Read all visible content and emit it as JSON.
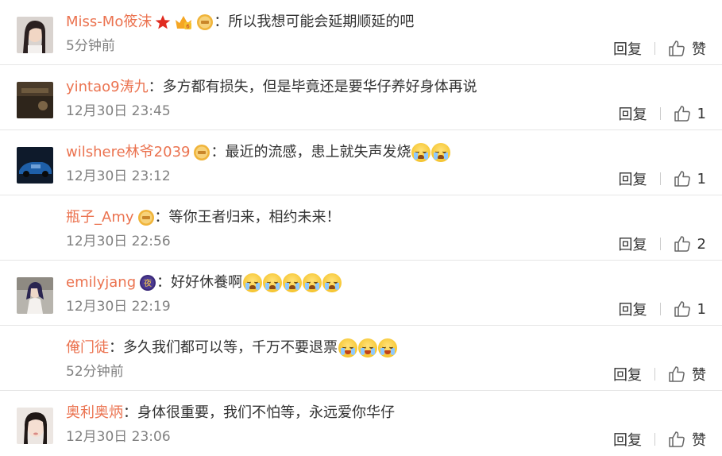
{
  "comments": [
    {
      "username": "Miss-Mo筱沫",
      "separator": "：",
      "text": "所以我想可能会延期顺延的吧",
      "time": "5分钟前",
      "reply_label": "回复",
      "like_label": "赞",
      "badges": [
        "star-badge",
        "crown-vip-badge",
        "gold-fan-badge"
      ],
      "emojis": []
    },
    {
      "username": "yintao9涛九",
      "separator": "：",
      "text": "多方都有损失，但是毕竟还是要华仔养好身体再说",
      "time": "12月30日 23:45",
      "reply_label": "回复",
      "like_label": "1",
      "badges": [],
      "emojis": []
    },
    {
      "username": "wilshere林爷2039",
      "separator": "：",
      "text": "最近的流感，患上就失声发烧",
      "time": "12月30日 23:12",
      "reply_label": "回复",
      "like_label": "1",
      "badges": [
        "gold-fan-badge"
      ],
      "emojis": [
        "crying-emoji",
        "crying-emoji"
      ]
    },
    {
      "username": "瓶子_Amy",
      "separator": "：",
      "text": "等你王者归来，相约未来！",
      "time": "12月30日 22:56",
      "reply_label": "回复",
      "like_label": "2",
      "badges": [
        "gold-fan-badge"
      ],
      "emojis": []
    },
    {
      "username": "emilyjang",
      "separator": "：",
      "text": "好好休養啊",
      "time": "12月30日 22:19",
      "reply_label": "回复",
      "like_label": "1",
      "badges": [
        "night-badge"
      ],
      "emojis": [
        "crying-emoji",
        "crying-emoji",
        "crying-emoji",
        "crying-emoji",
        "crying-emoji"
      ]
    },
    {
      "username": "俺门徒",
      "separator": "：",
      "text": "多久我们都可以等，千万不要退票",
      "time": "52分钟前",
      "reply_label": "回复",
      "like_label": "赞",
      "badges": [],
      "emojis": [
        "tears-of-joy-emoji",
        "tears-of-joy-emoji",
        "tears-of-joy-emoji"
      ]
    },
    {
      "username": "奥利奥炳",
      "separator": "：",
      "text": "身体很重要，我们不怕等，永远爱你华仔",
      "time": "12月30日 23:06",
      "reply_label": "回复",
      "like_label": "赞",
      "badges": [],
      "emojis": []
    }
  ],
  "colors": {
    "username": "#eb7350",
    "text": "#333333",
    "time": "#808080",
    "divider": "#e6e6e6"
  }
}
